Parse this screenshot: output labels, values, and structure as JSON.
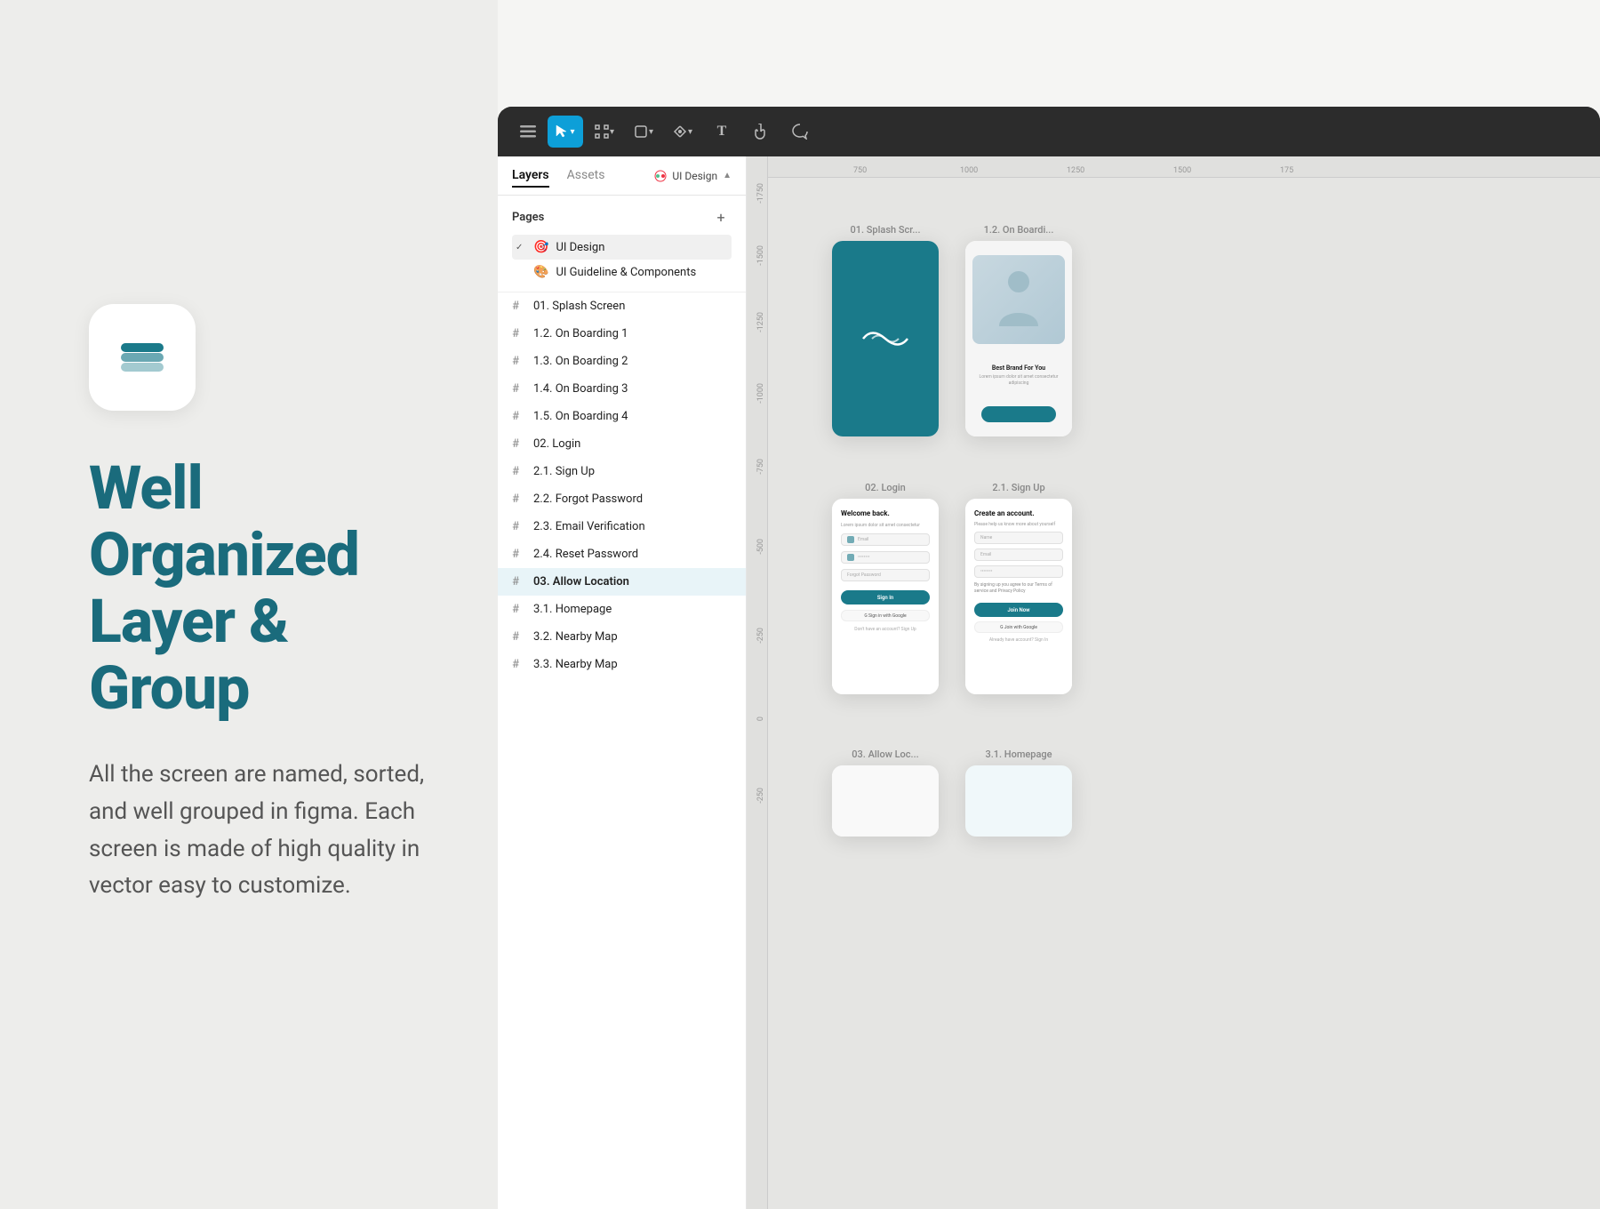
{
  "left": {
    "heading_line1": "Well Organized",
    "heading_line2": "Layer & Group",
    "description": "All the screen are named, sorted, and well grouped in figma. Each screen is made of high quality in vector easy to customize."
  },
  "toolbar": {
    "menu_icon": "☰",
    "tools": [
      {
        "id": "select",
        "label": "▶",
        "active": true
      },
      {
        "id": "frame",
        "label": "⊞",
        "active": false
      },
      {
        "id": "shape",
        "label": "□",
        "active": false
      },
      {
        "id": "pen",
        "label": "✒",
        "active": false
      },
      {
        "id": "text",
        "label": "T",
        "active": false
      },
      {
        "id": "hand",
        "label": "✋",
        "active": false
      },
      {
        "id": "comment",
        "label": "◯",
        "active": false
      }
    ]
  },
  "panel": {
    "tabs": [
      {
        "id": "layers",
        "label": "Layers",
        "active": true
      },
      {
        "id": "assets",
        "label": "Assets",
        "active": false
      }
    ],
    "badge": "UI Design",
    "pages_title": "Pages",
    "add_icon": "+",
    "pages": [
      {
        "name": "UI Design",
        "active": true,
        "emoji": "🎯"
      },
      {
        "name": "UI Guideline & Components",
        "active": false,
        "emoji": "🎨"
      }
    ],
    "layers": [
      {
        "name": "01. Splash Screen",
        "highlighted": false
      },
      {
        "name": "1.2. On Boarding 1",
        "highlighted": false
      },
      {
        "name": "1.3. On Boarding 2",
        "highlighted": false
      },
      {
        "name": "1.4. On Boarding 3",
        "highlighted": false
      },
      {
        "name": "1.5. On Boarding 4",
        "highlighted": false
      },
      {
        "name": "02. Login",
        "highlighted": false
      },
      {
        "name": "2.1. Sign Up",
        "highlighted": false
      },
      {
        "name": "2.2. Forgot Password",
        "highlighted": false
      },
      {
        "name": "2.3. Email Verification",
        "highlighted": false
      },
      {
        "name": "2.4. Reset Password",
        "highlighted": false
      },
      {
        "name": "03. Allow Location",
        "highlighted": true
      },
      {
        "name": "3.1. Homepage",
        "highlighted": false
      },
      {
        "name": "3.2. Nearby Map",
        "highlighted": false
      },
      {
        "name": "3.3. Nearby Map",
        "highlighted": false
      }
    ]
  },
  "canvas": {
    "ruler_marks_h": [
      "750",
      "1000",
      "1250",
      "1500",
      "175"
    ],
    "ruler_marks_v": [
      "-1750",
      "-1500",
      "-1250",
      "-1000",
      "-750",
      "-500",
      "-250",
      "0",
      "-250"
    ],
    "screens_top": [
      {
        "label": "01. Splash Scr...",
        "type": "splash"
      },
      {
        "label": "1.2. On Boardi...",
        "type": "onboarding"
      }
    ],
    "screens_middle": [
      {
        "label": "02. Login",
        "type": "login"
      },
      {
        "label": "2.1. Sign Up",
        "type": "signup"
      }
    ],
    "screens_bottom": [
      {
        "label": "03. Allow Loc...",
        "type": "allow"
      },
      {
        "label": "3.1. Homepage",
        "type": "homepage"
      }
    ]
  },
  "colors": {
    "teal": "#1a7a8a",
    "toolbar_bg": "#2c2c2c",
    "panel_bg": "#ffffff",
    "canvas_bg": "#e5e5e3",
    "active_tool": "#0d9fd8"
  }
}
